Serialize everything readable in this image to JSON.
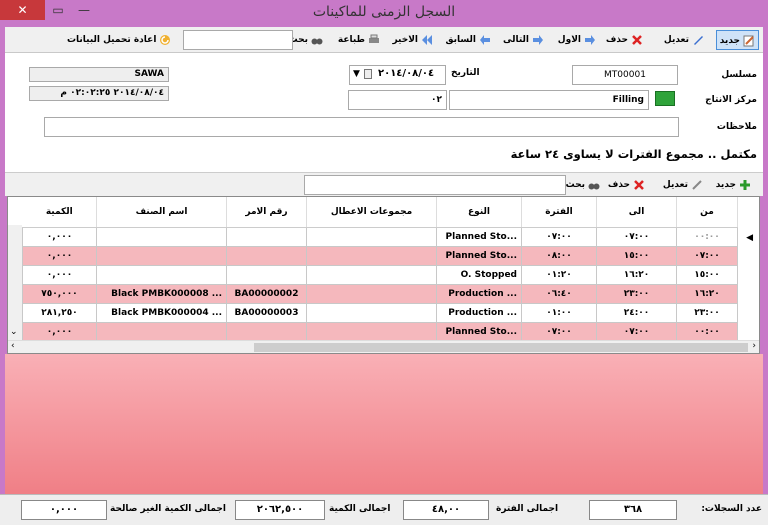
{
  "window": {
    "title": "السجل الزمنى للماكينات",
    "close": "✕",
    "maximize": "▭",
    "minimize": "—"
  },
  "toolbar": {
    "new": "جديد",
    "edit": "تعديل",
    "delete": "حذف",
    "first": "الاول",
    "next": "التالى",
    "prev": "السابق",
    "last": "الاخير",
    "print": "طباعة",
    "search": "بحث",
    "reload": "اعادة تحميل البيانات",
    "search_value": ""
  },
  "form": {
    "serial_label": "مسلسل",
    "serial_value": "MT00001",
    "date_label": "التاريخ",
    "date_value": "٢٠١٤/٠٨/٠٤",
    "center_label": "مركز الانتاج",
    "center_code": "٠٢",
    "center_name": "Filling",
    "notes_label": "ملاحظات",
    "notes_value": "",
    "user": "SAWA",
    "timestamp": "٢٠١٤/٠٨/٠٤ ٠٢:٠٢:٢٥ م"
  },
  "warning": "مكتمل .. مجموع الفترات لا يساوى ٢٤ ساعة",
  "subtoolbar": {
    "new": "جديد",
    "edit": "تعديل",
    "delete": "حذف",
    "search": "بحث",
    "search_value": ""
  },
  "grid": {
    "headers": [
      "الكمية",
      "اسم الصنف",
      "رقم الامر",
      "مجموعات الاعطال",
      "النوع",
      "الفترة",
      "الى",
      "من"
    ],
    "rows": [
      {
        "qty": "٠,٠٠٠",
        "item": "",
        "order": "",
        "faults": "",
        "type": "Planned Sto...",
        "period": "٠٧:٠٠",
        "to": "٠٧:٠٠",
        "from": "٠٠:٠٠"
      },
      {
        "qty": "٠,٠٠٠",
        "item": "",
        "order": "",
        "faults": "",
        "type": "Planned Sto...",
        "period": "٠٨:٠٠",
        "to": "١٥:٠٠",
        "from": "٠٧:٠٠"
      },
      {
        "qty": "٠,٠٠٠",
        "item": "",
        "order": "",
        "faults": "",
        "type": "O. Stopped",
        "period": "٠١:٢٠",
        "to": "١٦:٢٠",
        "from": "١٥:٠٠"
      },
      {
        "qty": "٧٥٠,٠٠٠",
        "item": "Black  PMBK000008 ...",
        "order": "BA00000002",
        "faults": "",
        "type": "Production ...",
        "period": "٠٦:٤٠",
        "to": "٢٣:٠٠",
        "from": "١٦:٢٠"
      },
      {
        "qty": "٢٨١,٢٥٠",
        "item": "Black  PMBK000004 ...",
        "order": "BA00000003",
        "faults": "",
        "type": "Production ...",
        "period": "٠١:٠٠",
        "to": "٢٤:٠٠",
        "from": "٢٣:٠٠"
      },
      {
        "qty": "٠,٠٠٠",
        "item": "",
        "order": "",
        "faults": "",
        "type": "Planned Sto...",
        "period": "٠٧:٠٠",
        "to": "٠٧:٠٠",
        "from": "٠٠:٠٠"
      }
    ]
  },
  "status": {
    "count_label": "عدد السجلات:",
    "count_value": "٣٦٨",
    "period_label": "اجمالى الفترة",
    "period_value": "٤٨,٠٠",
    "qty_label": "اجمالى الكمية",
    "qty_value": "٢٠٦٢,٥٠٠",
    "invalid_label": "اجمالى الكمية الغير صالحة",
    "invalid_value": "٠,٠٠٠"
  },
  "colors": {
    "title_bar": "#c879c8",
    "pink_row": "#f5b8bd",
    "close_red": "#c7383b"
  }
}
